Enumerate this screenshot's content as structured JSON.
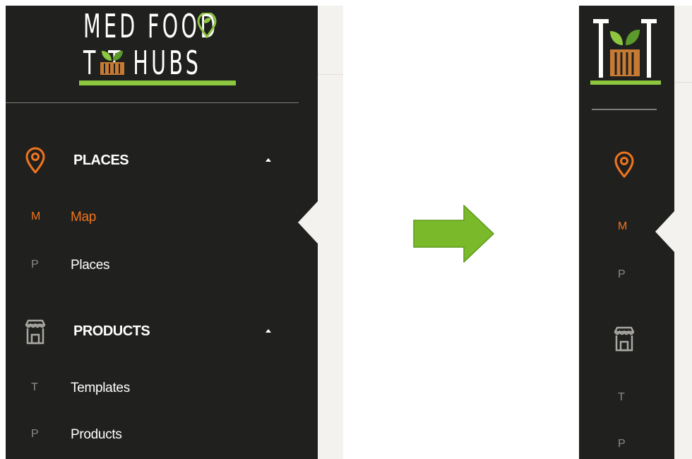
{
  "left_panel": {
    "logo": {
      "line1": "MED FOOD",
      "line2": "T  T HUBS"
    },
    "sections": [
      {
        "label": "PLACES",
        "icon": "map-pin-icon",
        "expanded": true,
        "items": [
          {
            "abbr": "M",
            "label": "Map",
            "active": true
          },
          {
            "abbr": "P",
            "label": "Places",
            "active": false
          }
        ]
      },
      {
        "label": "PRODUCTS",
        "icon": "store-icon",
        "expanded": true,
        "items": [
          {
            "abbr": "T",
            "label": "Templates",
            "active": false
          },
          {
            "abbr": "P",
            "label": "Products",
            "active": false
          }
        ]
      }
    ]
  },
  "arrow": {
    "icon": "right-arrow-icon",
    "color": "#7ab929"
  },
  "right_panel": {
    "logo_icon": "tat-logo-icon",
    "items": [
      {
        "icon": "map-pin-icon"
      },
      {
        "abbr": "M",
        "active": true
      },
      {
        "abbr": "P"
      },
      {
        "icon": "store-icon"
      },
      {
        "abbr": "T"
      },
      {
        "abbr": "P"
      }
    ]
  },
  "colors": {
    "sidebar_bg": "#20201e",
    "accent": "#f0741d",
    "brand_green": "#8dc63f",
    "content_bg": "#f4f2ef"
  }
}
